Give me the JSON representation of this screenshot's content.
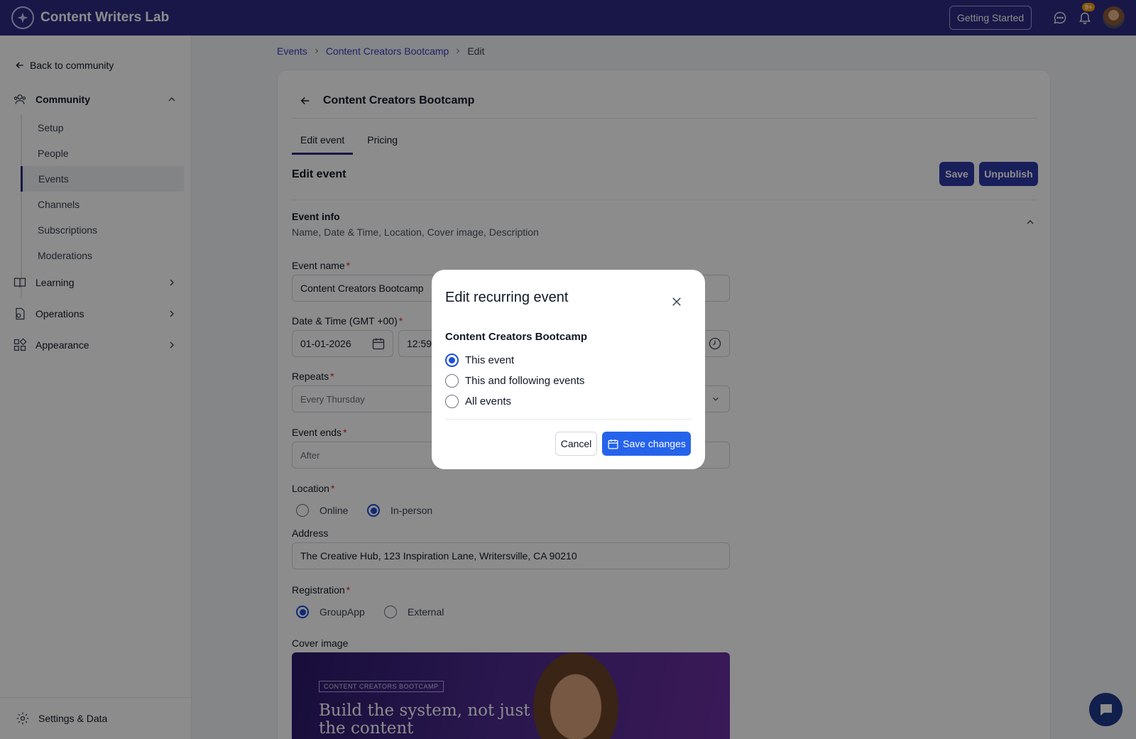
{
  "app": {
    "title": "Content Writers Lab"
  },
  "topbar": {
    "getting_started": "Getting Started",
    "notification_count": "9+"
  },
  "sidebar": {
    "back_label": "Back to community",
    "community_label": "Community",
    "community_items": [
      "Setup",
      "People",
      "Events",
      "Channels",
      "Subscriptions",
      "Moderations"
    ],
    "active_item": "Events",
    "learning_label": "Learning",
    "operations_label": "Operations",
    "appearance_label": "Appearance",
    "settings_label": "Settings & Data"
  },
  "breadcrumb": {
    "events": "Events",
    "event": "Content Creators Bootcamp",
    "current": "Edit"
  },
  "card": {
    "title": "Content Creators Bootcamp",
    "tabs": [
      "Edit event",
      "Pricing"
    ],
    "section_title": "Edit event",
    "save_label": "Save",
    "unpublish_label": "Unpublish",
    "info_title": "Event info",
    "info_subtitle": "Name, Date & Time, Location, Cover image, Description"
  },
  "form": {
    "event_name_label": "Event name",
    "event_name_value": "Content Creators Bootcamp",
    "datetime_label": "Date & Time (GMT +00)",
    "date_value": "01-01-2026",
    "time_value": "12:59",
    "repeats_label": "Repeats",
    "repeats_value": "Every Thursday",
    "event_ends_label": "Event ends",
    "event_ends_value": "After",
    "location_label": "Location",
    "location_options": [
      "Online",
      "In-person"
    ],
    "location_selected": "In-person",
    "address_label": "Address",
    "address_value": "The Creative Hub, 123 Inspiration Lane, Writersville, CA 90210",
    "registration_label": "Registration",
    "registration_options": [
      "GroupApp",
      "External"
    ],
    "registration_selected": "GroupApp",
    "cover_label": "Cover image",
    "cover_tag": "CONTENT CREATORS BOOTCAMP",
    "cover_headline": "Build the system, not just the content"
  },
  "modal": {
    "title": "Edit recurring event",
    "subtitle": "Content Creators Bootcamp",
    "options": [
      "This event",
      "This and following events",
      "All events"
    ],
    "selected": "This event",
    "cancel_label": "Cancel",
    "save_label": "Save changes"
  },
  "colors": {
    "topbar": "#2d2a84",
    "primary": "#2d3aa6",
    "modal_primary": "#2563eb",
    "required": "#dc2626"
  },
  "icons": [
    "logo-icon",
    "chat-icon",
    "bell-icon",
    "arrow-left-icon",
    "community-icon",
    "chevron-up-icon",
    "book-icon",
    "operations-icon",
    "appearance-icon",
    "chevron-right-icon",
    "gear-icon",
    "calendar-icon",
    "clock-icon",
    "chevron-down-icon",
    "close-icon",
    "chat-bubble-icon"
  ]
}
